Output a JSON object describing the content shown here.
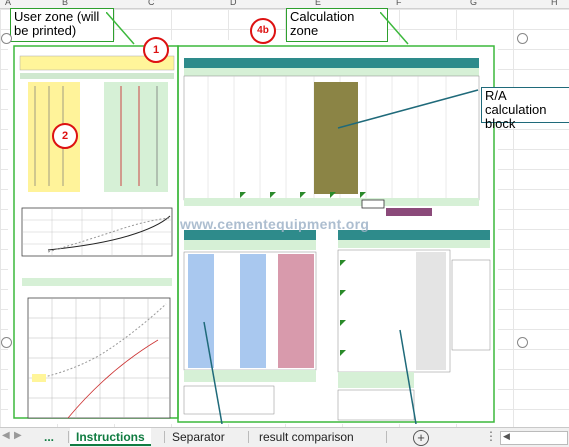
{
  "columns": [
    "A",
    "B",
    "C",
    "D",
    "E",
    "F",
    "G",
    "H"
  ],
  "callouts": {
    "user_zone": "User zone (will be printed)",
    "calculation_zone": "Calculation zone",
    "ra_block": "R/A calculation block"
  },
  "badges": [
    "1",
    "2",
    "4b"
  ],
  "watermark": "www.cementequipment.org",
  "tabs": {
    "more": "...",
    "instructions": "Instructions",
    "separator": "Separator",
    "result_comparison": "result comparison"
  },
  "colors": {
    "frame_green": "#3cb83c",
    "tab_active": "#107c41",
    "badge_red": "#dd1111",
    "teal_header": "#2e8b8b"
  }
}
